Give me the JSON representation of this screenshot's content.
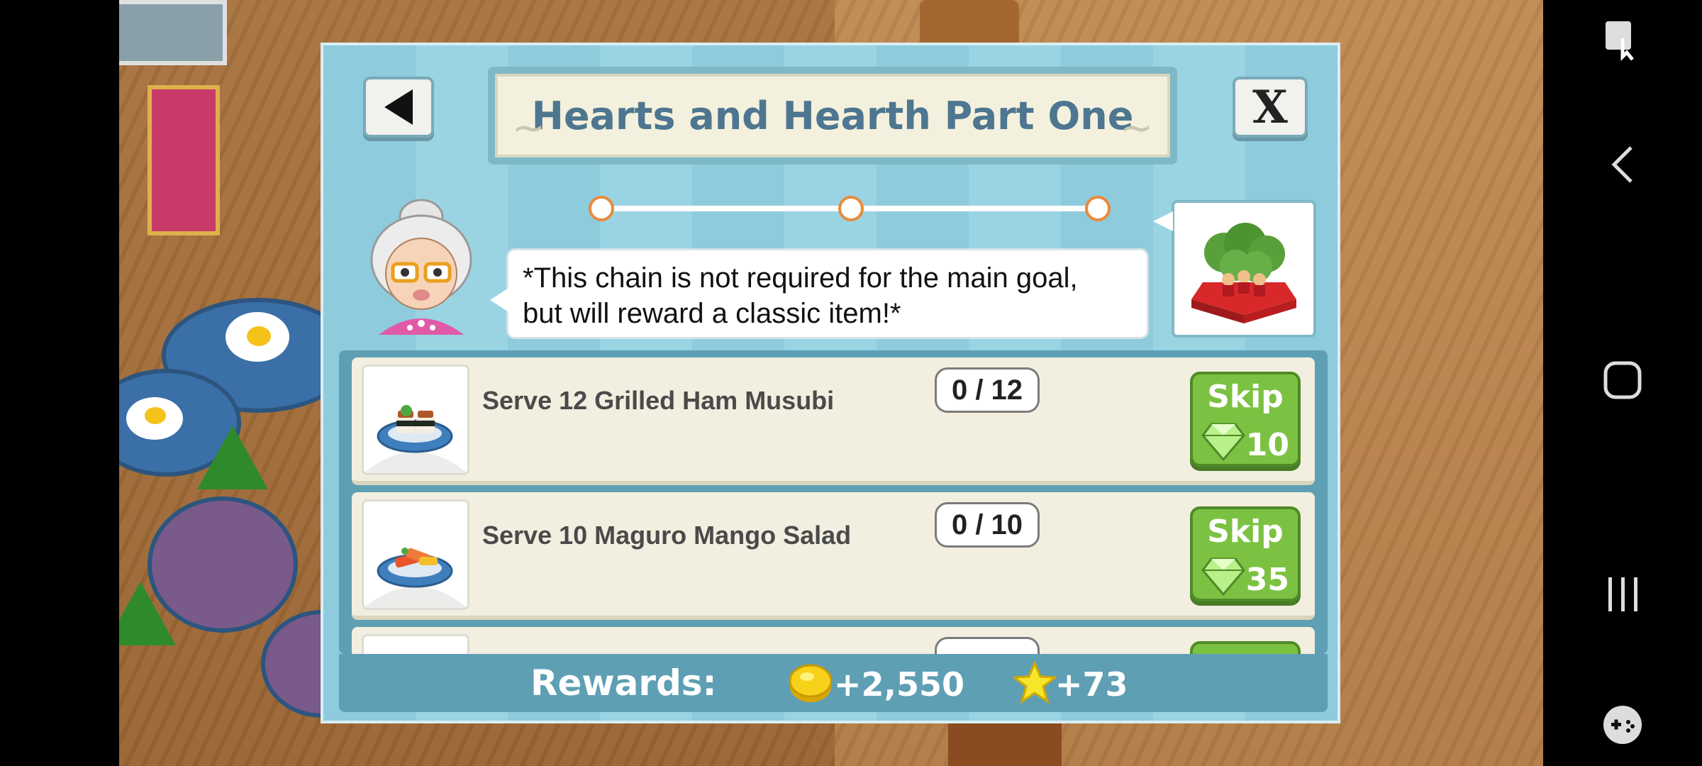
{
  "quest": {
    "title": "Hearts and Hearth Part One",
    "note_line1": "*This chain is not required for the main goal,",
    "note_line2": "but will reward a classic item!*",
    "progress_fraction": 0.0,
    "progress_steps": 3
  },
  "tasks": [
    {
      "label": "Serve 12 Grilled Ham Musubi",
      "count": "0 / 12",
      "skip_label": "Skip",
      "skip_cost": "10"
    },
    {
      "label": "Serve 10 Maguro Mango Salad",
      "count": "0 / 10",
      "skip_label": "Skip",
      "skip_cost": "35"
    }
  ],
  "rewards": {
    "label": "Rewards:",
    "coins": "+2,550",
    "stars": "+73"
  },
  "controls": {
    "close_label": "X"
  },
  "colors": {
    "dialog_bg": "#8ecbdc",
    "accent_orange": "#e88a3a",
    "skip_green": "#7cc242",
    "title_color": "#4e7690"
  }
}
